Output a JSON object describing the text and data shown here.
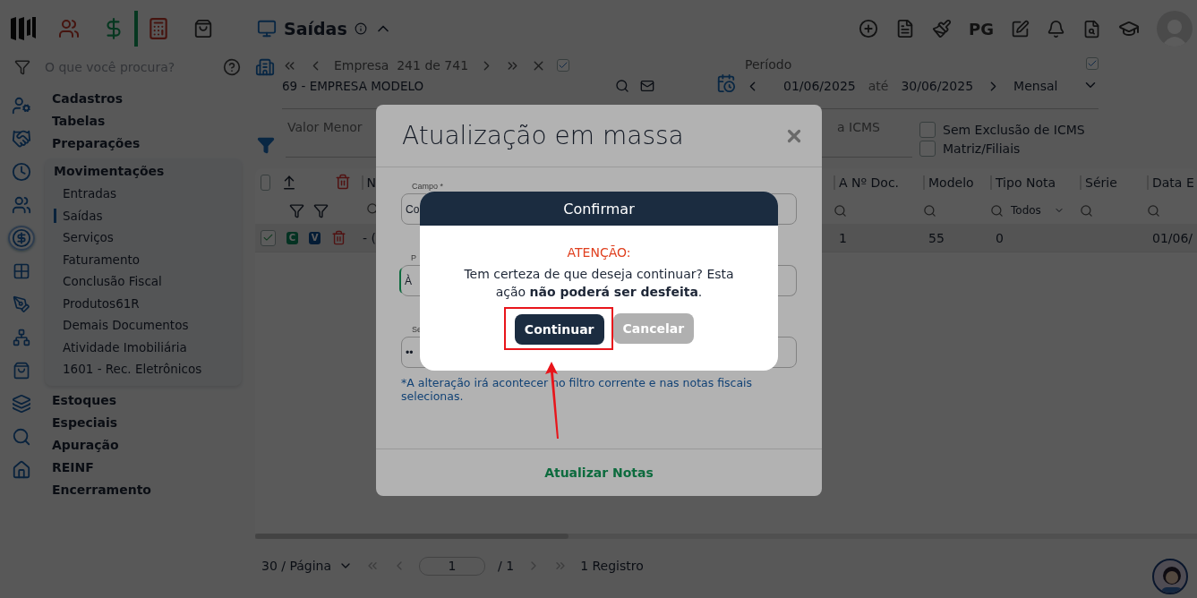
{
  "header_modules": [
    {
      "selected": false
    },
    {
      "selected": true
    },
    {
      "selected": false
    },
    {
      "selected": false
    }
  ],
  "search": {
    "placeholder": "O que você procura?"
  },
  "rail": [
    {
      "selected": false
    },
    {
      "selected": false
    },
    {
      "selected": false
    },
    {
      "selected": false
    },
    {
      "selected": true
    },
    {
      "selected": false
    },
    {
      "selected": false
    },
    {
      "selected": false
    },
    {
      "selected": false
    },
    {
      "selected": false
    },
    {
      "selected": false
    },
    {
      "selected": false
    }
  ],
  "sidebar": {
    "items": [
      {
        "label": "Cadastros",
        "expanded": false
      },
      {
        "label": "Tabelas",
        "expanded": false
      },
      {
        "label": "Preparações",
        "expanded": false
      },
      {
        "label": "Movimentações",
        "expanded": true,
        "children": [
          {
            "label": "Entradas",
            "selected": false
          },
          {
            "label": "Saídas",
            "selected": true
          },
          {
            "label": "Serviços",
            "selected": false
          },
          {
            "label": "Faturamento",
            "selected": false
          },
          {
            "label": "Conclusão Fiscal",
            "selected": false
          },
          {
            "label": "Produtos61R",
            "selected": false
          },
          {
            "label": "Demais Documentos",
            "selected": false
          },
          {
            "label": "Atividade Imobiliária",
            "selected": false
          },
          {
            "label": "1601 - Rec. Eletrônicos",
            "selected": false
          }
        ]
      },
      {
        "label": "Estoques",
        "expanded": false
      },
      {
        "label": "Especiais",
        "expanded": false
      },
      {
        "label": "Apuração",
        "expanded": false
      },
      {
        "label": "REINF",
        "expanded": false
      },
      {
        "label": "Encerramento",
        "expanded": false
      }
    ]
  },
  "page_title": "Saídas",
  "toolbar_text": "PG",
  "company": {
    "position": "Empresa  241 de 741",
    "all_checked": true,
    "name": "69 - EMPRESA MODELO"
  },
  "period": {
    "label": "Período",
    "start": "01/06/2025",
    "separator": "até",
    "end": "30/06/2025",
    "mode": "Mensal",
    "checked": true
  },
  "filters": {
    "field_1": "Valor Menor",
    "field_2": "a ICMS",
    "options": [
      {
        "label": "Sem Exclusão de ICMS",
        "checked": false
      },
      {
        "label": "Matriz/Filiais",
        "checked": false
      }
    ]
  },
  "table": {
    "all_checked": false,
    "left_column": "N",
    "columns": [
      "A Nº Doc.",
      "Modelo",
      "Tipo Nota",
      "Série",
      "Data E"
    ],
    "type_filter": "Todos",
    "rows": [
      {
        "checked": true,
        "badges": [
          "C",
          "V"
        ],
        "lead": "- (",
        "cells": [
          "1",
          "55",
          "0",
          null,
          "01/06/"
        ]
      }
    ]
  },
  "pagination": {
    "page_size": "30 / Página",
    "page": "1",
    "pages": "/ 1",
    "records": "1 Registro"
  },
  "mass_update": {
    "title": "Atualização em massa",
    "fields": [
      {
        "label": "Campo *",
        "value": "Co"
      },
      {
        "label": "P",
        "value": "À"
      },
      {
        "label": "Se",
        "value": "••"
      }
    ],
    "note": "*A alteração irá acontecer no filtro corrente e nas notas fiscais selecionas.",
    "action": "Atualizar Notas"
  },
  "confirm": {
    "title": "Confirmar",
    "warning": "ATENÇÃO:",
    "message": "Tem certeza de que deseja continuar? Esta ação **não poderá ser desfeita**.",
    "buttons": [
      {
        "label": "Continuar",
        "kind": "primary",
        "highlighted": true
      },
      {
        "label": "Cancelar",
        "kind": "secondary",
        "highlighted": false
      }
    ]
  }
}
